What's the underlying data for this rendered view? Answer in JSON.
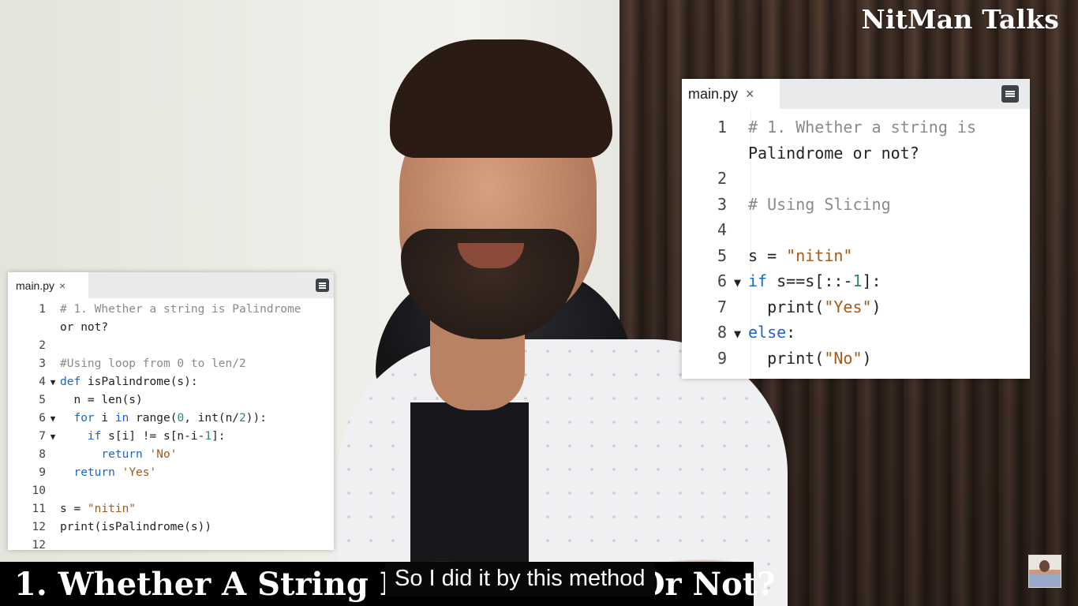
{
  "channel_brand": "NitMan Talks",
  "video_title": "1. Whether A String Is Palindrome Or Not?",
  "subtitle": "So I did it by this method",
  "editor_right": {
    "tab_label": "main.py",
    "tab_close": "×",
    "lines": [
      {
        "n": "1",
        "fold": "",
        "text": "# 1. Whether a string is"
      },
      {
        "n": "",
        "fold": "",
        "text": "Palindrome or not?"
      },
      {
        "n": "2",
        "fold": "",
        "text": ""
      },
      {
        "n": "3",
        "fold": "",
        "text": "# Using Slicing"
      },
      {
        "n": "4",
        "fold": "",
        "text": ""
      },
      {
        "n": "5",
        "fold": "",
        "text": "s = \"nitin\""
      },
      {
        "n": "6",
        "fold": "▼",
        "text": "if s==s[::-1]:"
      },
      {
        "n": "7",
        "fold": "",
        "text": "  print(\"Yes\")"
      },
      {
        "n": "8",
        "fold": "▼",
        "text": "else:"
      },
      {
        "n": "9",
        "fold": "",
        "text": "  print(\"No\")"
      }
    ]
  },
  "editor_left": {
    "tab_label": "main.py",
    "tab_close": "×",
    "lines": [
      {
        "n": "1",
        "fold": "",
        "text": "# 1. Whether a string is Palindrome"
      },
      {
        "n": "",
        "fold": "",
        "text": "or not?"
      },
      {
        "n": "2",
        "fold": "",
        "text": ""
      },
      {
        "n": "3",
        "fold": "",
        "text": "#Using loop from 0 to len/2"
      },
      {
        "n": "4",
        "fold": "▼",
        "text": "def isPalindrome(s):"
      },
      {
        "n": "5",
        "fold": "",
        "text": "  n = len(s)"
      },
      {
        "n": "6",
        "fold": "▼",
        "text": "  for i in range(0, int(n/2)):"
      },
      {
        "n": "7",
        "fold": "▼",
        "text": "    if s[i] != s[n-i-1]:"
      },
      {
        "n": "8",
        "fold": "",
        "text": "      return 'No'"
      },
      {
        "n": "9",
        "fold": "",
        "text": "  return 'Yes'"
      },
      {
        "n": "10",
        "fold": "",
        "text": ""
      },
      {
        "n": "11",
        "fold": "",
        "text": "s = \"nitin\""
      },
      {
        "n": "12",
        "fold": "",
        "text": "print(isPalindrome(s))"
      },
      {
        "n": "12",
        "fold": "",
        "text": ""
      }
    ]
  }
}
